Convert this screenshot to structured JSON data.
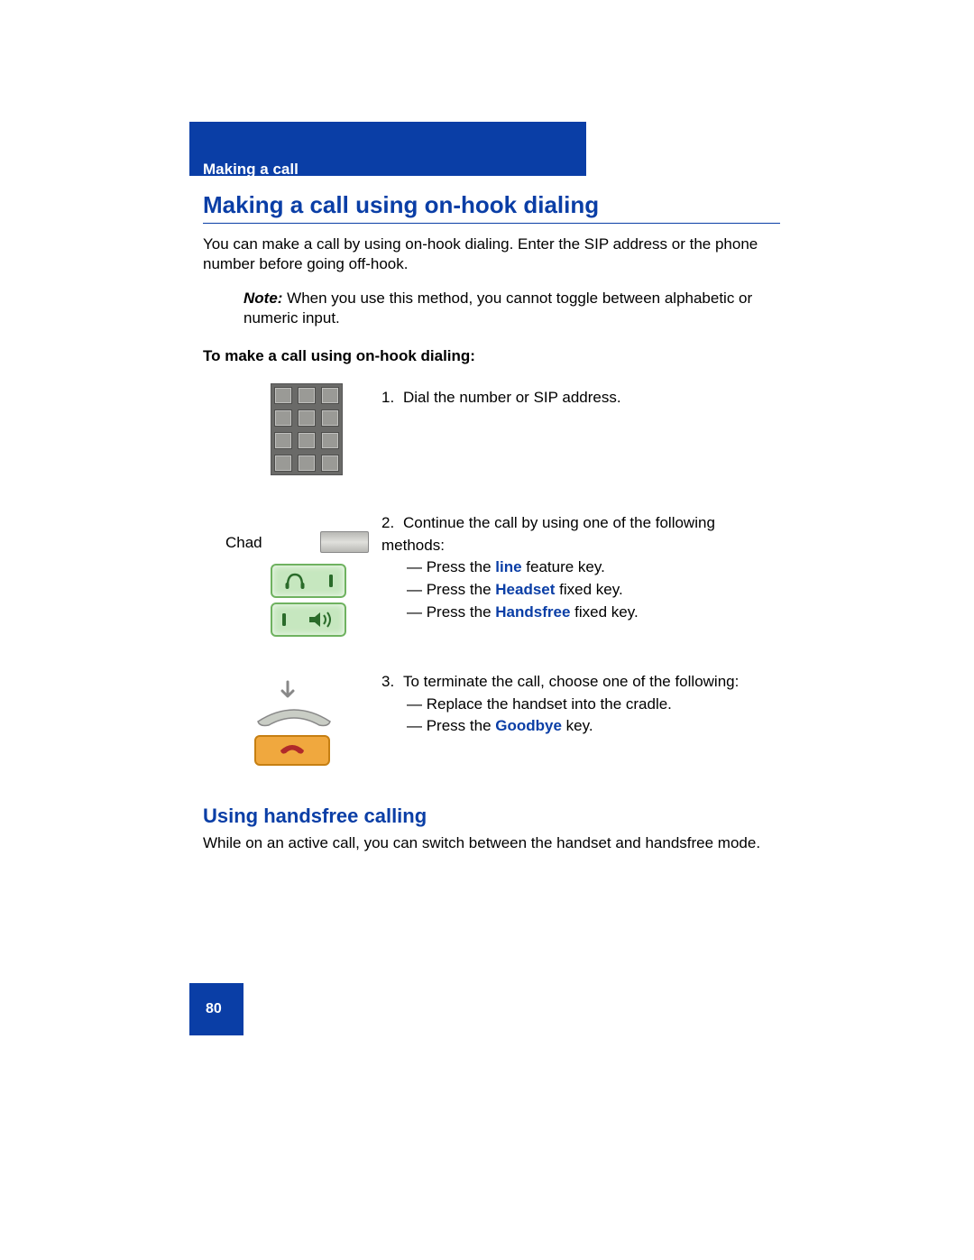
{
  "header": {
    "section": "Making a call",
    "title": "Making a call using on-hook dialing"
  },
  "intro": "You can make a call by using on-hook dialing. Enter the SIP address or the phone number before going off-hook.",
  "note": {
    "label": "Note:",
    "text": " When you use this method, you cannot toggle between alphabetic or numeric input."
  },
  "subhead": "To make a call using on-hook dialing:",
  "step1": {
    "num": "1.",
    "text": "Dial the number or SIP address."
  },
  "chad": "Chad",
  "step2": {
    "num": "2.",
    "lead": "Continue the call by using one of the following methods:",
    "a_pre": "— Press the ",
    "a_key": "line",
    "a_post": " feature key.",
    "b_pre": "— Press the ",
    "b_key": "Headset",
    "b_post": " fixed key.",
    "c_pre": "— Press the ",
    "c_key": "Handsfree",
    "c_post": " fixed key."
  },
  "step3": {
    "num": "3.",
    "lead": "To terminate the call, choose one of the following:",
    "a": "— Replace the handset into the cradle.",
    "b_pre": "— Press the ",
    "b_key": "Goodbye",
    "b_post": " key."
  },
  "h2": "Using handsfree calling",
  "body2": "While on an active call, you can switch between the handset and handsfree mode.",
  "page_num": "80"
}
